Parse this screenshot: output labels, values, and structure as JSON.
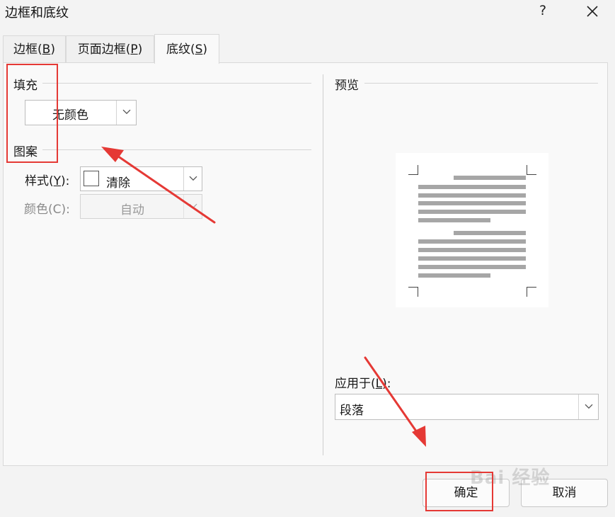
{
  "window": {
    "title": "边框和底纹",
    "help": "?"
  },
  "tabs": [
    {
      "pre": "边框(",
      "key": "B",
      "post": ")"
    },
    {
      "pre": "页面边框(",
      "key": "P",
      "post": ")"
    },
    {
      "pre": "底纹(",
      "key": "S",
      "post": ")"
    }
  ],
  "fill": {
    "group": "填充",
    "color_value": "无颜色"
  },
  "pattern": {
    "group": "图案",
    "style_label_pre": "样式(",
    "style_label_key": "Y",
    "style_label_post": "):",
    "style_value": "清除",
    "color_label": "颜色(C):",
    "color_value": "自动"
  },
  "preview": {
    "group": "预览",
    "apply_label_pre": "应用于(",
    "apply_label_key": "L",
    "apply_label_post": "):",
    "apply_value": "段落"
  },
  "buttons": {
    "ok": "确定",
    "cancel": "取消"
  },
  "watermark": "Bai 经验",
  "colors": {
    "annotation": "#e53935",
    "preview_lines": "#a6a6a6"
  }
}
